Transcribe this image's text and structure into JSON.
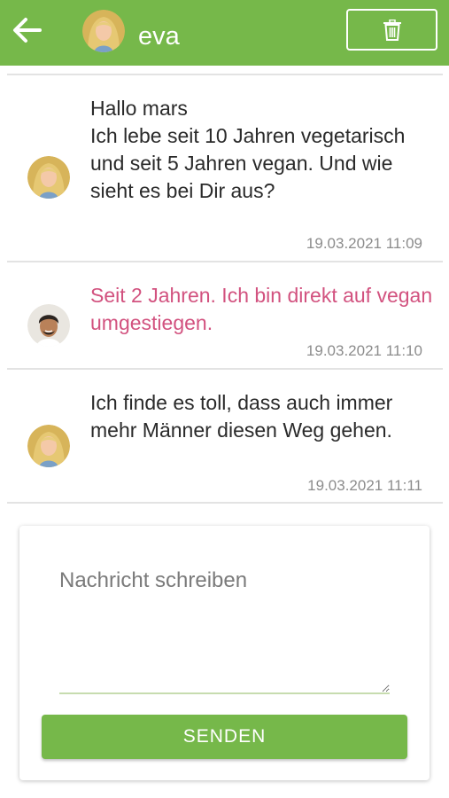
{
  "colors": {
    "primary_green": "#76b84a",
    "own_message_pink": "#d2527f",
    "timestamp_gray": "#8c8c8c",
    "divider_gray": "#e3e3e3"
  },
  "header": {
    "back_icon": "arrow-left-icon",
    "contact_name": "eva",
    "avatar_icon": "contact-avatar",
    "delete_icon": "trash-icon"
  },
  "messages": [
    {
      "sender": "contact",
      "text": "Hallo mars\nIch lebe seit 10 Jahren vegetarisch und seit 5 Jahren vegan. Und wie sieht es bei Dir aus?",
      "timestamp": "19.03.2021 11:09"
    },
    {
      "sender": "self",
      "text": "Seit 2 Jahren. Ich bin direkt auf vegan umgestiegen.",
      "timestamp": "19.03.2021 11:10"
    },
    {
      "sender": "contact",
      "text": "Ich finde es toll, dass auch immer mehr Männer diesen Weg gehen.",
      "timestamp": "19.03.2021 11:11"
    }
  ],
  "compose": {
    "placeholder": "Nachricht schreiben",
    "value": "",
    "send_label": "SENDEN"
  }
}
